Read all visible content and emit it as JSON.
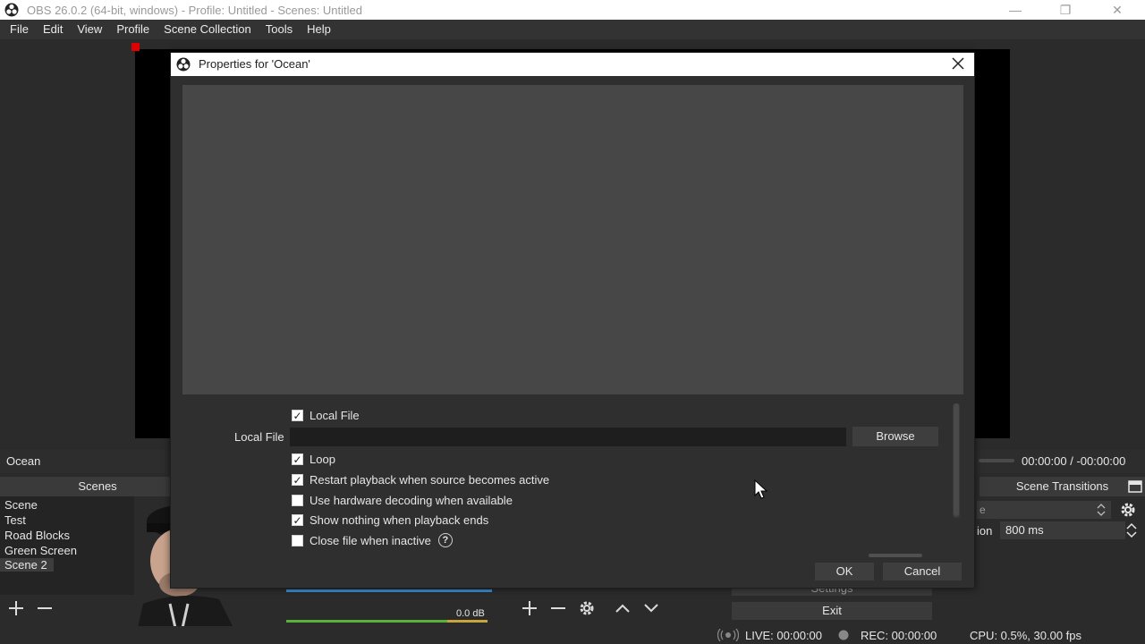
{
  "window": {
    "title": "OBS 26.0.2 (64-bit, windows) - Profile: Untitled - Scenes: Untitled",
    "minimize_glyph": "—",
    "restore_glyph": "❐",
    "close_glyph": "✕"
  },
  "menu": [
    "File",
    "Edit",
    "View",
    "Profile",
    "Scene Collection",
    "Tools",
    "Help"
  ],
  "source_bar": {
    "source_name": "Ocean",
    "timecode": "00:00:00 / -00:00:00"
  },
  "scenes": {
    "title": "Scenes",
    "items": [
      "Scene",
      "Test",
      "Road Blocks",
      "Green Screen",
      "Scene 2"
    ],
    "selected_index": 4
  },
  "audio": {
    "level": "0.0 dB"
  },
  "transitions": {
    "title": "Scene Transitions",
    "selected_partial": "e",
    "duration_label_partial": "ion",
    "duration_value": "800 ms"
  },
  "controls": {
    "settings": "Settings",
    "exit": "Exit"
  },
  "status": {
    "live": "LIVE: 00:00:00",
    "rec": "REC: 00:00:00",
    "cpu": "CPU: 0.5%, 30.00 fps"
  },
  "dialog": {
    "title": "Properties for 'Ocean'",
    "properties": {
      "local_file_checkbox": {
        "label": "Local File",
        "checked": true
      },
      "local_file_field_label": "Local File",
      "local_file_value": "",
      "browse_label": "Browse",
      "loop": {
        "label": "Loop",
        "checked": true
      },
      "restart": {
        "label": "Restart playback when source becomes active",
        "checked": true
      },
      "hw_decoding": {
        "label": "Use hardware decoding when available",
        "checked": false
      },
      "show_nothing": {
        "label": "Show nothing when playback ends",
        "checked": true
      },
      "close_file": {
        "label": "Close file when inactive",
        "checked": false
      }
    },
    "ok_label": "OK",
    "cancel_label": "Cancel"
  },
  "icons": {
    "app_logo": "obs-logo-icon",
    "help": "help-icon",
    "add": "plus-icon",
    "remove": "minus-icon",
    "settings": "gear-icon",
    "up": "chevron-up-icon",
    "down": "chevron-down-icon"
  }
}
